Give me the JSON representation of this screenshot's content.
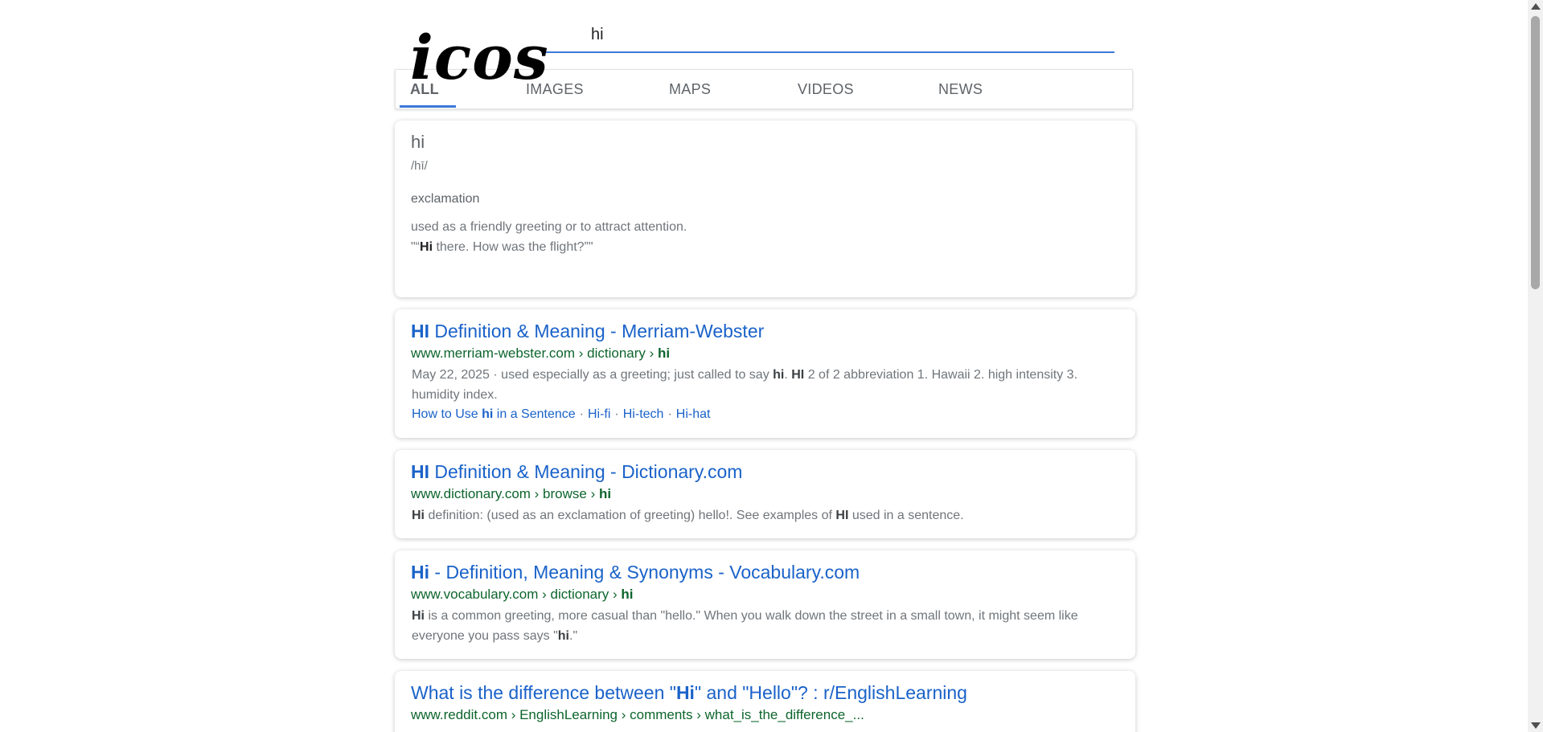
{
  "logo": {
    "text": "icos"
  },
  "search": {
    "value": "hi"
  },
  "tabs": [
    {
      "label": "ALL",
      "active": true
    },
    {
      "label": "IMAGES"
    },
    {
      "label": "MAPS"
    },
    {
      "label": "VIDEOS"
    },
    {
      "label": "NEWS"
    }
  ],
  "dictionary": {
    "word": "hi",
    "pronunciation": "/hī/",
    "part_of_speech": "exclamation",
    "definition": "used as a friendly greeting or to attract attention.",
    "example_prefix": "\"“",
    "example_bold": "Hi",
    "example_rest": " there. How was the flight?”\""
  },
  "results": [
    {
      "title_bold": "HI",
      "title_rest": " Definition & Meaning - Merriam-Webster",
      "url_prefix": "www.merriam-webster.com › dictionary › ",
      "url_bold": "hi",
      "snippet_1": "May 22, 2025 · used especially as a greeting; just called to say ",
      "snippet_b1": "hi",
      "snippet_2": ". ",
      "snippet_b2": "HI",
      "snippet_3": " 2 of 2 abbreviation 1. Hawaii 2. high intensity 3. humidity index.",
      "sitelinks": {
        "first_prefix": "How to Use ",
        "first_bold": "hi",
        "first_suffix": " in a Sentence",
        "second": "Hi-fi",
        "third": "Hi-tech",
        "fourth": "Hi-hat",
        "separator": "·"
      }
    },
    {
      "title_bold": "HI",
      "title_rest": " Definition & Meaning - Dictionary.com",
      "url_prefix": "www.dictionary.com › browse › ",
      "url_bold": "hi",
      "snippet_b1": "Hi",
      "snippet_1": " definition: (used as an exclamation of greeting) hello!. See examples of ",
      "snippet_b2": "HI",
      "snippet_2": " used in a sentence."
    },
    {
      "title_bold": "Hi",
      "title_rest": " - Definition, Meaning & Synonyms - Vocabulary.com",
      "url_prefix": "www.vocabulary.com › dictionary › ",
      "url_bold": "hi",
      "snippet_b1": "Hi",
      "snippet_1": " is a common greeting, more casual than \"hello.\" When you walk down the street in a small town, it might seem like everyone you pass says \"",
      "snippet_b2": "hi",
      "snippet_2": ".\""
    },
    {
      "title_prefix": "What is the difference between \"",
      "title_bold": "Hi",
      "title_rest": "\" and \"Hello\"? : r/EnglishLearning",
      "url_prefix": "www.reddit.com › EnglishLearning › comments › what_is_the_difference_..."
    }
  ]
}
